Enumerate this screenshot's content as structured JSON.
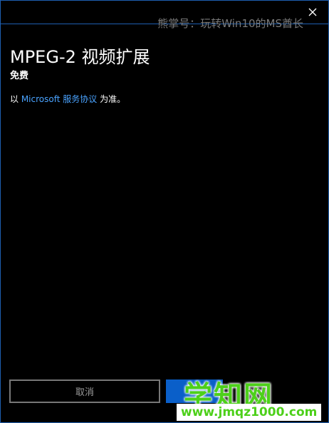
{
  "watermark_top": "熊掌号：玩转Win10的MS酋长",
  "close_icon": "close-icon",
  "title": "MPEG-2 视频扩展",
  "price": "免费",
  "terms": {
    "prefix": "以 ",
    "link": "Microsoft 服务协议",
    "suffix": " 为准。"
  },
  "buttons": {
    "cancel": "取消"
  },
  "watermark_logo": "学知网",
  "watermark_url": "www.jmqz1000.com",
  "colors": {
    "accent": "#0a5fc9",
    "border": "#1e5fb0",
    "link": "#4aa3ff",
    "watermark_green": "#4dd01a"
  }
}
